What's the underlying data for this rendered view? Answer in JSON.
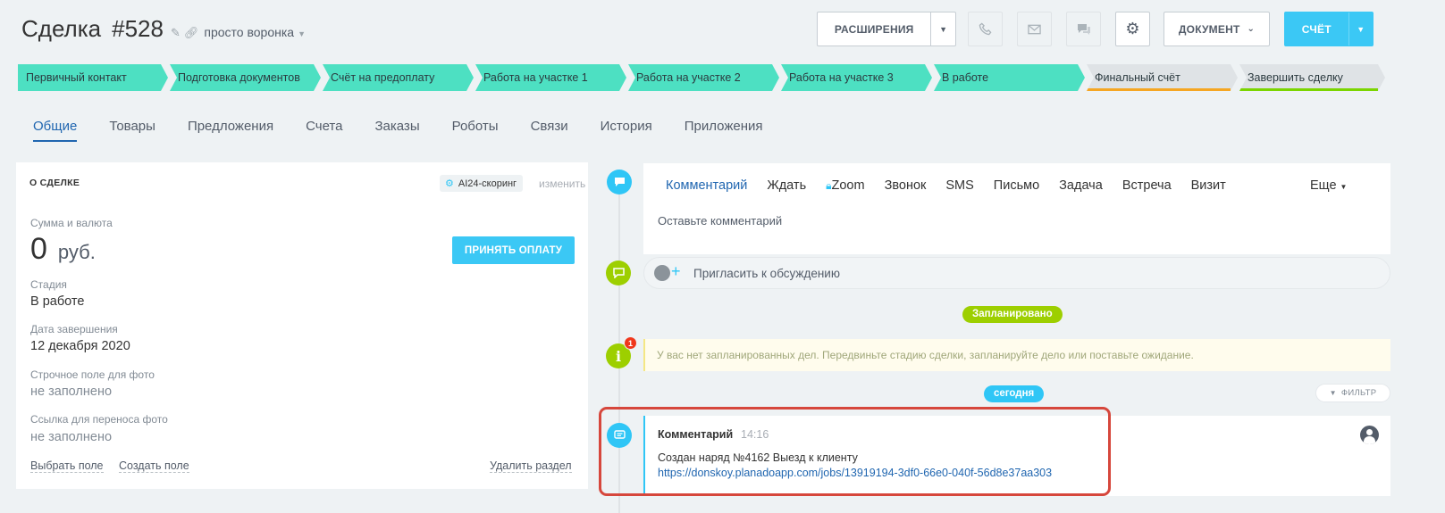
{
  "header": {
    "title": "Сделка",
    "deal_number": "#528",
    "funnel": "просто воронка",
    "extensions_label": "РАСШИРЕНИЯ",
    "document_label": "ДОКУМЕНТ",
    "invoice_label": "СЧЁТ",
    "icons": [
      "phone-icon",
      "mail-icon",
      "chat-icon",
      "gear-icon"
    ]
  },
  "stages": [
    {
      "label": "Первичный контакт",
      "color": "#4de0c2"
    },
    {
      "label": "Подготовка документов",
      "color": "#4de0c2"
    },
    {
      "label": "Счёт на предоплату",
      "color": "#4de0c2"
    },
    {
      "label": "Работа на участке 1",
      "color": "#4de0c2"
    },
    {
      "label": "Работа на участке 2",
      "color": "#4de0c2"
    },
    {
      "label": "Работа на участке 3",
      "color": "#4de0c2"
    },
    {
      "label": "В работе",
      "color": "#4de0c2"
    },
    {
      "label": "Финальный счёт",
      "color": "#dfe3e6",
      "accent": "#f5a623"
    },
    {
      "label": "Завершить сделку",
      "color": "#dfe3e6",
      "accent": "#7bd500"
    }
  ],
  "tabs": [
    "Общие",
    "Товары",
    "Предложения",
    "Счета",
    "Заказы",
    "Роботы",
    "Связи",
    "История",
    "Приложения"
  ],
  "about": {
    "heading": "О СДЕЛКЕ",
    "ai_chip": "AI24-скоринг",
    "change": "изменить",
    "amount_label": "Сумма и валюта",
    "amount": "0",
    "currency": "руб.",
    "pay_button": "ПРИНЯТЬ ОПЛАТУ",
    "stage_label": "Стадия",
    "stage_value": "В работе",
    "close_date_label": "Дата завершения",
    "close_date_value": "12 декабря 2020",
    "photo_field_label": "Строчное поле для фото",
    "photo_field_value": "не заполнено",
    "photo_link_label": "Ссылка для переноса фото",
    "photo_link_value": "не заполнено",
    "choose_field": "Выбрать поле",
    "create_field": "Создать поле",
    "delete_section": "Удалить раздел"
  },
  "timeline": {
    "composer_tabs": [
      "Комментарий",
      "Ждать",
      "Zoom",
      "Звонок",
      "SMS",
      "Письмо",
      "Задача",
      "Встреча",
      "Визит"
    ],
    "more": "Еще",
    "placeholder": "Оставьте комментарий",
    "invite": "Пригласить к обсуждению",
    "planned": "Запланировано",
    "notice_badge": "1",
    "notice": "У вас нет запланированных дел. Передвиньте стадию сделки, запланируйте дело или поставьте ожидание.",
    "today": "сегодня",
    "filter": "ФИЛЬТР",
    "comment": {
      "title": "Комментарий",
      "time": "14:16",
      "text": "Создан наряд №4162 Выезд к клиенту",
      "link": "https://donskoy.planadoapp.com/jobs/13919194-3df0-66e0-040f-56d8e37aa303"
    }
  }
}
